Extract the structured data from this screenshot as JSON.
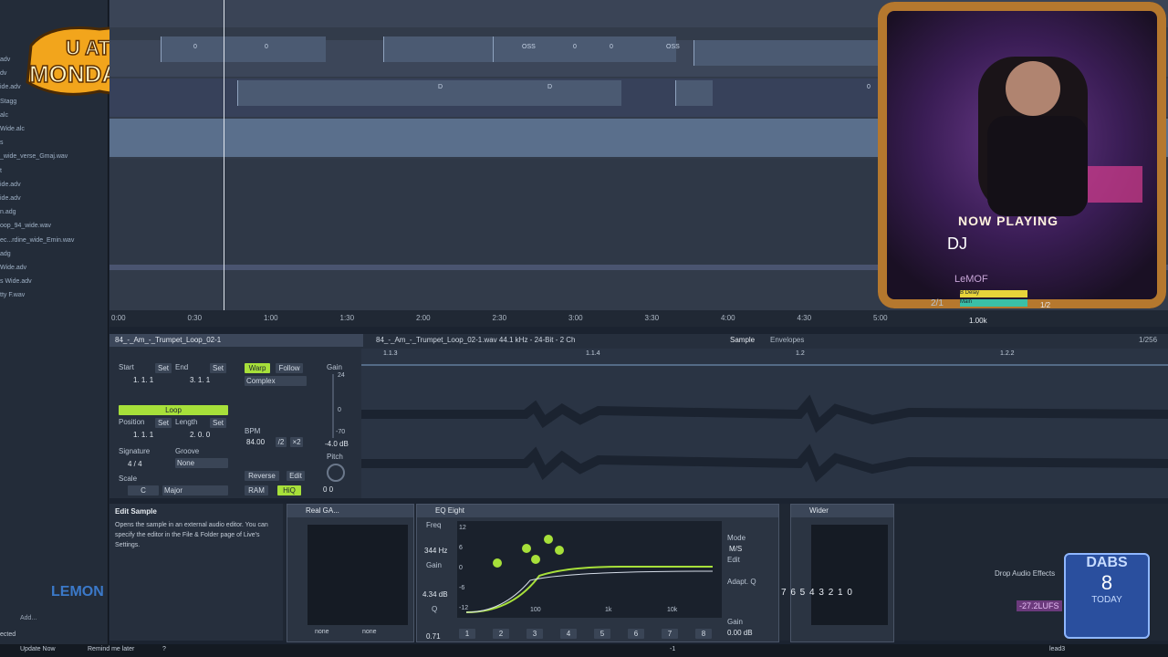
{
  "sidebar": {
    "files": [
      {
        "label": "adv"
      },
      {
        "label": "dv"
      },
      {
        "label": "ide.adv"
      },
      {
        "label": "Stagg"
      },
      {
        "label": "alc"
      },
      {
        "label": "Wide.alc"
      },
      {
        "label": "s"
      },
      {
        "label": "_wide_verse_Gmaj.wav"
      },
      {
        "label": "t"
      },
      {
        "label": "ide.adv"
      },
      {
        "label": "ide.adv"
      },
      {
        "label": "n.adg"
      },
      {
        "label": "oop_94_wide.wav"
      },
      {
        "label": "ec...rdine_wide_Emin.wav"
      },
      {
        "label": "adg"
      },
      {
        "label": "Wide.adv"
      },
      {
        "label": "s Wide.adv"
      },
      {
        "label": "tty F.wav"
      }
    ]
  },
  "overlay": {
    "logo_line1": "U ATE",
    "logo_line2": "MONDAYS?",
    "now_playing": "NOW PLAYING",
    "dj": "DJ",
    "dj_name": "LeMOF",
    "dabs": "DABS",
    "dabs_count": "8",
    "dabs_sub": "TODAY",
    "lemon": "LEMON"
  },
  "arrangement": {
    "clip_labels": [
      "0",
      "0",
      "OSS",
      "OSS",
      "0",
      "0",
      "D",
      "D",
      "0"
    ],
    "ruler": [
      "0:00",
      "0:30",
      "1:00",
      "1:30",
      "2:00",
      "2:30",
      "3:00",
      "3:30",
      "4:00",
      "4:30",
      "5:00"
    ],
    "page": "2/1"
  },
  "clip": {
    "title": "84_-_Am_-_Trumpet_Loop_02-1",
    "file_info": "84_-_Am_-_Trumpet_Loop_02-1.wav 44.1 kHz - 24-Bit - 2 Ch",
    "tab_sample": "Sample",
    "tab_envelopes": "Envelopes",
    "zoom": "1/256",
    "start_label": "Start",
    "end_label": "End",
    "set": "Set",
    "start_val": "1.   1.   1",
    "end_val": "3.   1.   1",
    "warp": "Warp",
    "follow": "Follow",
    "warp_mode": "Complex",
    "loop": "Loop",
    "position_label": "Position",
    "length_label": "Length",
    "position_val": "1.   1.   1",
    "length_val": "2.   0.   0",
    "signature_label": "Signature",
    "signature_val": "4  /  4",
    "groove_label": "Groove",
    "groove_val": "None",
    "scale_label": "Scale",
    "scale_root": "C",
    "scale_mode": "Major",
    "bpm_label": "BPM",
    "bpm_val": "84.00",
    "half": "/2",
    "double": "×2",
    "reverse": "Reverse",
    "edit": "Edit",
    "ram": "RAM",
    "hiq": "HiQ",
    "gain_label": "Gain",
    "gain_val": "-4.0 dB",
    "gain_top": "24",
    "gain_mid": "0",
    "gain_low": "-70",
    "pitch_label": "Pitch",
    "pitch_vals": "0    0",
    "markers": [
      "1.1.3",
      "1.1.4",
      "1.2",
      "1.2.2"
    ]
  },
  "info": {
    "title": "Edit Sample",
    "text": "Opens the sample in an external audio editor. You can specify the editor in the File & Folder page of Live's Settings."
  },
  "devices": {
    "realga": "Real GA...",
    "eq_title": "EQ Eight",
    "freq_label": "Freq",
    "freq_val": "344 Hz",
    "gain_label": "Gain",
    "gain_val": "4.34 dB",
    "q_label": "Q",
    "q_val": "0.71",
    "mode_label": "Mode",
    "mode_val": "M/S",
    "edit_label": "Edit",
    "adapt_q": "Adapt. Q",
    "eq_gain": "Gain",
    "eq_gain_val": "0.00 dB",
    "eq_scale": [
      "12",
      "6",
      "0",
      "-6",
      "-12"
    ],
    "eq_freqs": [
      "100",
      "1k",
      "10k"
    ],
    "band_nums": [
      "1",
      "2",
      "3",
      "4",
      "5",
      "6",
      "7",
      "8"
    ],
    "wider_title": "Wider",
    "none1": "none",
    "none2": "none",
    "drop_fx": "Drop Audio Effects",
    "lufs": "-27.2LUFS",
    "meter_nums": "7 6 5 4 3 2 1 0"
  },
  "mixer": {
    "fraction": "1/2",
    "vol": "1.00k",
    "tracks": [
      "B Delay",
      "Main"
    ]
  },
  "statusbar": {
    "update": "Update Now",
    "remind": "Remind me later",
    "q": "?",
    "selected": "ected",
    "add": "Add...",
    "lead": "lead3",
    "minus": "-1"
  },
  "colors": {
    "accent_green": "#a7e03a",
    "bg": "#1b2330",
    "frame_gold": "#b5782e",
    "purple": "#8a3fcf"
  }
}
